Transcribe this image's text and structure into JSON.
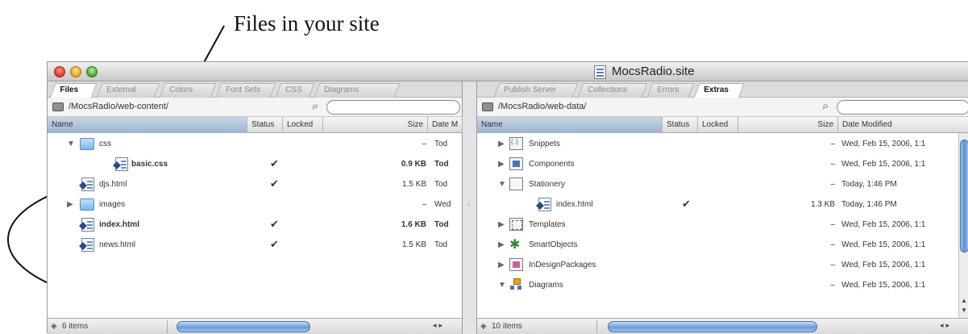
{
  "caption": "Files in your site",
  "window": {
    "title": "MocsRadio.site"
  },
  "left_panel": {
    "tabs": [
      {
        "label": "Files",
        "active": true
      },
      {
        "label": "External",
        "active": false
      },
      {
        "label": "Colors",
        "active": false
      },
      {
        "label": "Font Sets",
        "active": false
      },
      {
        "label": "CSS",
        "active": false
      },
      {
        "label": "Diagrams",
        "active": false
      }
    ],
    "path": "/MocsRadio/web-content/",
    "columns": {
      "name": "Name",
      "status": "Status",
      "locked": "Locked",
      "size": "Size",
      "date": "Date M"
    },
    "rows": [
      {
        "name": "css",
        "status": "",
        "size": "–",
        "date": "Tod"
      },
      {
        "name": "basic.css",
        "status": "✔",
        "size": "0.9 KB",
        "date": "Tod"
      },
      {
        "name": "djs.html",
        "status": "✔",
        "size": "1.5 KB",
        "date": "Tod"
      },
      {
        "name": "images",
        "status": "",
        "size": "–",
        "date": "Wed"
      },
      {
        "name": "index.html",
        "status": "✔",
        "size": "1.6 KB",
        "date": "Tod"
      },
      {
        "name": "news.html",
        "status": "✔",
        "size": "1.5 KB",
        "date": "Tod"
      }
    ],
    "status": {
      "count": "6 items"
    }
  },
  "right_panel": {
    "tabs": [
      {
        "label": "Publish Server",
        "active": false
      },
      {
        "label": "Collections",
        "active": false
      },
      {
        "label": "Errors",
        "active": false
      },
      {
        "label": "Extras",
        "active": true
      }
    ],
    "path": "/MocsRadio/web-data/",
    "columns": {
      "name": "Name",
      "status": "Status",
      "locked": "Locked",
      "size": "Size",
      "date": "Date Modified"
    },
    "rows": [
      {
        "name": "Snippets",
        "status": "",
        "size": "–",
        "date": "Wed, Feb 15, 2006, 1:1"
      },
      {
        "name": "Components",
        "status": "",
        "size": "–",
        "date": "Wed, Feb 15, 2006, 1:1"
      },
      {
        "name": "Stationery",
        "status": "",
        "size": "–",
        "date": "Today, 1:46 PM"
      },
      {
        "name": "index.html",
        "status": "✔",
        "size": "1.3 KB",
        "date": "Today, 1:46 PM"
      },
      {
        "name": "Templates",
        "status": "",
        "size": "–",
        "date": "Wed, Feb 15, 2006, 1:1"
      },
      {
        "name": "SmartObjects",
        "status": "",
        "size": "–",
        "date": "Wed, Feb 15, 2006, 1:1"
      },
      {
        "name": "InDesignPackages",
        "status": "",
        "size": "–",
        "date": "Wed, Feb 15, 2006, 1:1"
      },
      {
        "name": "Diagrams",
        "status": "",
        "size": "–",
        "date": "Wed, Feb 15, 2006, 1:1"
      }
    ],
    "status": {
      "count": "10 items"
    }
  }
}
